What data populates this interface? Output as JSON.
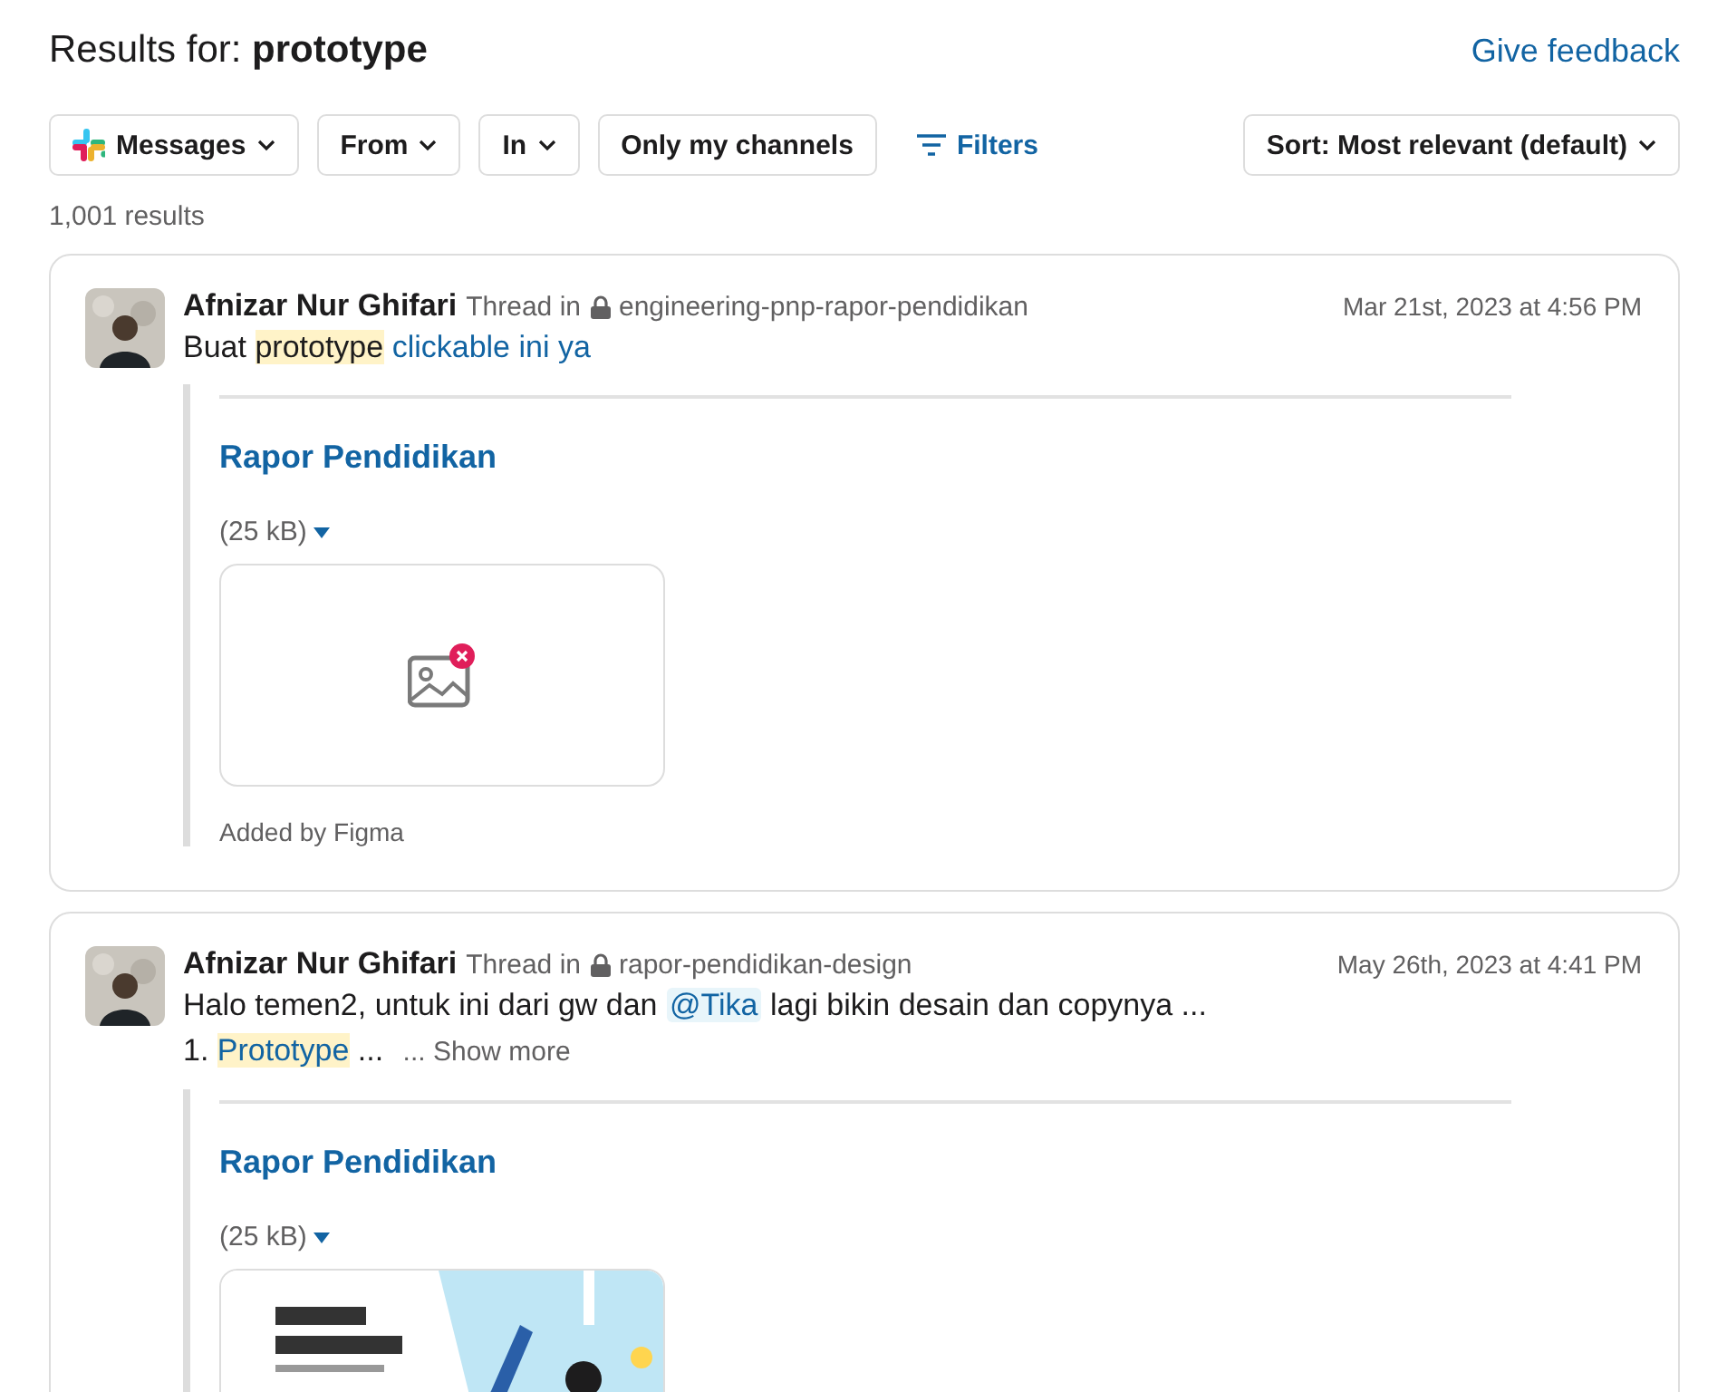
{
  "header": {
    "label": "Results for:",
    "query": "prototype",
    "feedback": "Give feedback"
  },
  "filters": [
    {
      "kind": "app",
      "label": "Messages"
    },
    {
      "kind": "dropdown",
      "label": "From"
    },
    {
      "kind": "dropdown",
      "label": "In"
    },
    {
      "kind": "plain",
      "label": "Only my channels"
    },
    {
      "kind": "filters",
      "label": "Filters"
    }
  ],
  "sort": {
    "label": "Sort: Most relevant (default)"
  },
  "result_count": "1,001 results",
  "results": [
    {
      "author": "Afnizar Nur Ghifari",
      "context": "Thread in",
      "channel": "engineering-pnp-rapor-pendidikan",
      "time": "Mar 21st, 2023 at 4:56 PM",
      "lines": [
        [
          {
            "kind": "text",
            "text": "Buat "
          },
          {
            "kind": "highlight",
            "text": "prototype"
          },
          {
            "kind": "link",
            "text": " clickable ini ya"
          }
        ]
      ],
      "attachment": {
        "title": "Rapor Pendidikan",
        "size": "(25 kB)",
        "image_broken": true,
        "footer": "Added by Figma"
      }
    },
    {
      "author": "Afnizar Nur Ghifari",
      "context": "Thread in",
      "channel": "rapor-pendidikan-design",
      "time": "May 26th, 2023 at 4:41 PM",
      "lines": [
        [
          {
            "kind": "text",
            "text": "Halo temen2, untuk ini dari gw dan "
          },
          {
            "kind": "mention",
            "text": "@Tika"
          },
          {
            "kind": "text",
            "text": " lagi bikin desain dan copynya ..."
          }
        ],
        [
          {
            "kind": "text",
            "text": "1. "
          },
          {
            "kind": "highlight_link",
            "text": "Prototype"
          },
          {
            "kind": "text",
            "text": " ... "
          },
          {
            "kind": "more",
            "text": "... Show more"
          }
        ]
      ],
      "attachment": {
        "title": "Rapor Pendidikan",
        "size": "(25 kB)",
        "image_broken": false
      }
    }
  ]
}
